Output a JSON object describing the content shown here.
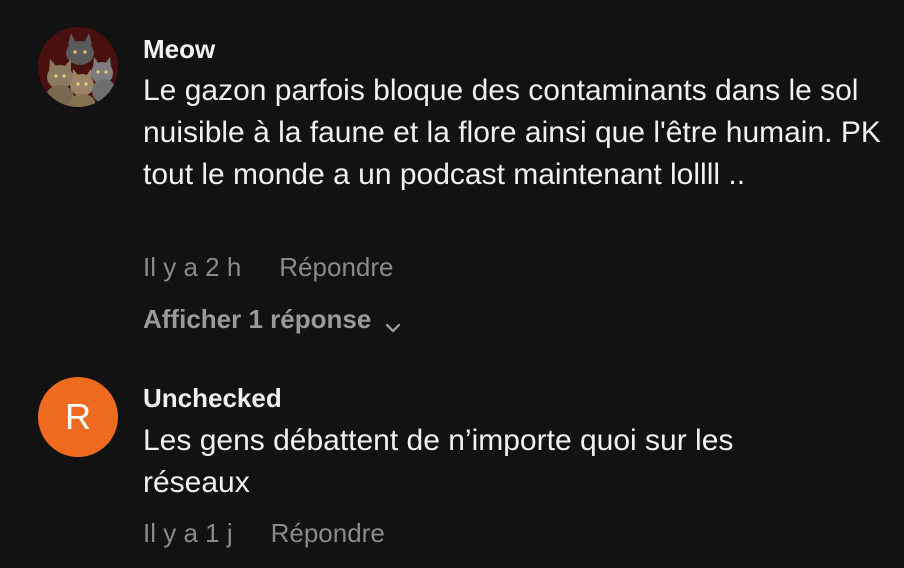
{
  "comments": [
    {
      "author": "Meow",
      "avatar": "cats-photo-avatar",
      "text": "Le gazon parfois bloque des contaminants dans le sol nuisible à la faune et la flore ainsi que l'être humain. PK tout le monde a un podcast maintenant lollll ..",
      "time": "Il y a 2 h",
      "reply_label": "Répondre",
      "replies_label": "Afficher 1 réponse"
    },
    {
      "author": "Unchecked",
      "avatar_letter": "R",
      "avatar_color": "#ee6a1f",
      "text": "Les gens débattent de n’importe quoi sur les réseaux",
      "time": "Il y a 1 j",
      "reply_label": "Répondre"
    }
  ]
}
